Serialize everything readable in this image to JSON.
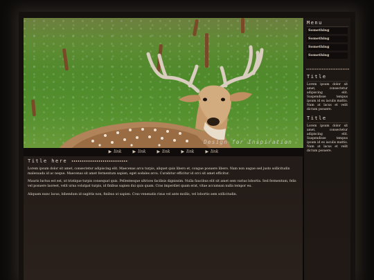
{
  "hero": {
    "credit": "Design for Inspiration"
  },
  "nav": {
    "links": [
      "link",
      "link",
      "link",
      "link",
      "link"
    ]
  },
  "main": {
    "title": "Title here",
    "paragraphs": [
      "Lorem ipsum dolor sit amet, consectetur adipiscing elit. Maecenas arcu turpis, aliquet quis libero et, congue posuere libero. Nam non augue sed justo sollicitudin malesuada id ac neque. Maecenas sit amet fermentum sapien, eget sodales arcu. Curabitur efficitur id orci sit amet efficitur.",
      "Mauris luctus est est, ut tristique turpis consequat quis. Pellentesque ultrices facilisis dignissim. Nulla faucibus elit sit amet sem varius lobortis. Sed fermentum, felis vel posuere laoreet, velit urna volutpat turpis, id finibus sapien dui quis quam. Cras imperdiet quam erat, vitae accumsan nulla tempor eu.",
      "Aliquam nunc lacus, bibendum id sagittis non, finibus ut sapien. Cras venenatis risus vel ante mollis, vel lobortis sem sollicitudin."
    ]
  },
  "sidebar": {
    "menu_title": "Menu",
    "menu_items": [
      "Something",
      "Something",
      "Something",
      "Something"
    ],
    "box1_title": "Title",
    "box1_text": "Lorem ipsum dolor sit amet, consectetur adipiscing elit. Suspendisse tempus ipsum id ex iaculis mattis. Nam at lacus et velit dictum posuere.",
    "box2_title": "Title",
    "box2_text": "Lorem ipsum dolor sit amet, consectetur adipiscing elit. Suspendisse tempus ipsum id ex iaculis mattis. Nam at lacus et velit dictum posuere."
  },
  "colors": {
    "background": "#0d0b0a",
    "panel": "#1d1816",
    "text": "#e8ddd2",
    "grass": "#4f8a2b",
    "deer_coat": "#b08358"
  }
}
